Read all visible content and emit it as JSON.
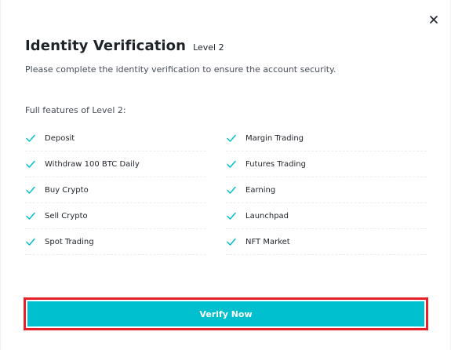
{
  "modal": {
    "title": "Identity Verification",
    "level_badge": "Level 2",
    "subtitle": "Please complete the identity verification to ensure the account security.",
    "features_heading": "Full features of Level 2:",
    "features": [
      {
        "label": "Deposit",
        "icon": "check-icon"
      },
      {
        "label": "Margin Trading",
        "icon": "check-icon"
      },
      {
        "label": "Withdraw 100 BTC Daily",
        "icon": "check-icon"
      },
      {
        "label": "Futures Trading",
        "icon": "check-icon"
      },
      {
        "label": "Buy Crypto",
        "icon": "check-icon"
      },
      {
        "label": "Earning",
        "icon": "check-icon"
      },
      {
        "label": "Sell Crypto",
        "icon": "check-icon"
      },
      {
        "label": "Launchpad",
        "icon": "check-icon"
      },
      {
        "label": "Spot Trading",
        "icon": "check-icon"
      },
      {
        "label": "NFT Market",
        "icon": "check-icon"
      }
    ],
    "verify_button_label": "Verify Now",
    "close_icon": "close-icon"
  },
  "colors": {
    "accent": "#00c0cf",
    "check": "#00c0cf",
    "highlight_border": "#e5212b",
    "text": "#1e2329"
  }
}
